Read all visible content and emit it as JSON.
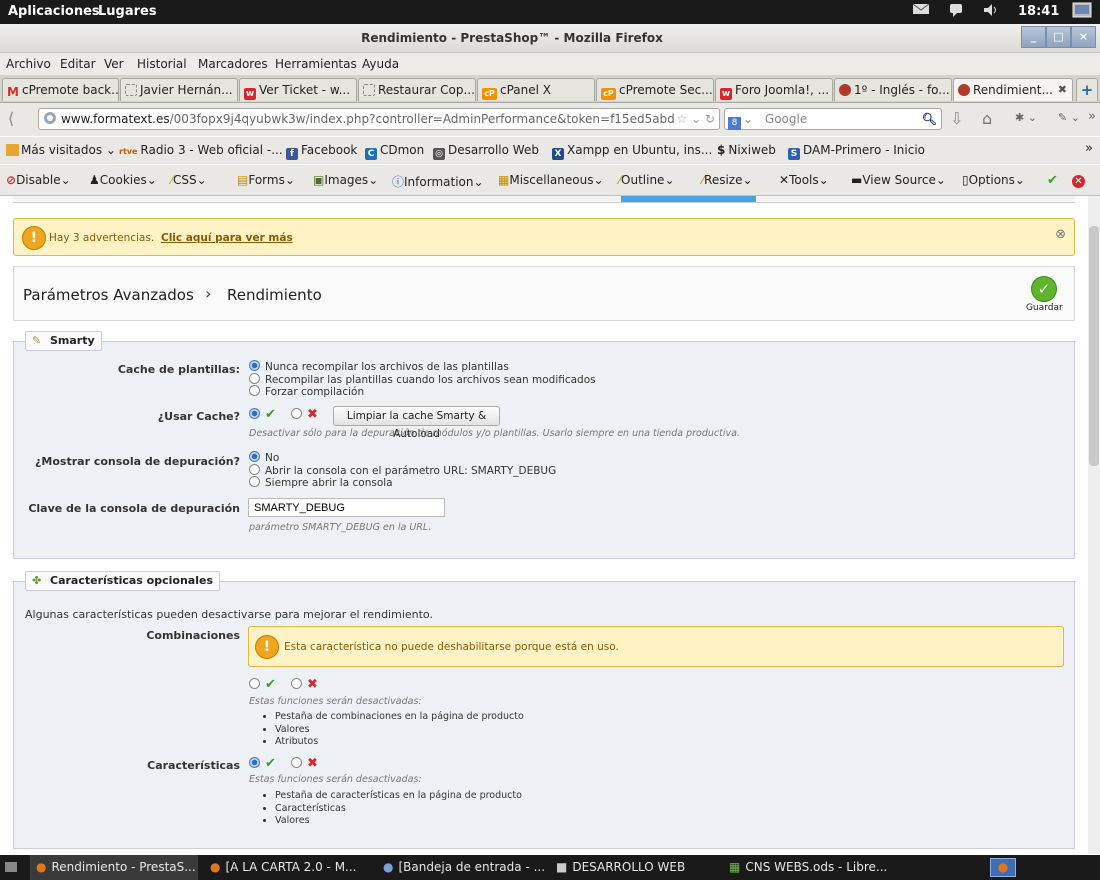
{
  "gnome_panel": {
    "apps_menu": "Aplicaciones",
    "places_menu": "Lugares",
    "clock": "18:41"
  },
  "window": {
    "title": "Rendimiento - PrestaShop™ - Mozilla Firefox",
    "minimize": "_",
    "maximize": "□",
    "close": "×"
  },
  "menubar": [
    "Archivo",
    "Editar",
    "Ver",
    "Historial",
    "Marcadores",
    "Herramientas",
    "Ayuda"
  ],
  "tabs": [
    {
      "label": "cPremote back...",
      "favicon": "gmail-icon",
      "favicon_color": "#d93025",
      "favicon_char": "M"
    },
    {
      "label": "Javier Hernán...",
      "favicon": "blank-page-icon",
      "favicon_color": "#ffffff",
      "favicon_char": ""
    },
    {
      "label": "Ver Ticket - w...",
      "favicon": "w-icon",
      "favicon_color": "#d8262a",
      "favicon_char": "w"
    },
    {
      "label": "Restaurar Cop...",
      "favicon": "blank-page-icon",
      "favicon_color": "#ffffff",
      "favicon_char": ""
    },
    {
      "label": "cPanel X",
      "favicon": "cpanel-icon",
      "favicon_color": "#f39200",
      "favicon_char": "cP"
    },
    {
      "label": "cPremote Sec...",
      "favicon": "cpanel-icon",
      "favicon_color": "#f39200",
      "favicon_char": "cP"
    },
    {
      "label": "Foro Joomla!, ...",
      "favicon": "w-icon",
      "favicon_color": "#d8262a",
      "favicon_char": "w"
    },
    {
      "label": "1º - Inglés - fo...",
      "favicon": "prestashop-icon",
      "favicon_color": "#b33a2a",
      "favicon_char": ""
    },
    {
      "label": "Rendimient...",
      "favicon": "prestashop-icon",
      "favicon_color": "#b33a2a",
      "favicon_char": ""
    }
  ],
  "tab_close": "✖",
  "new_tab": "+",
  "navbar": {
    "url_domain": "www.formatext.es",
    "url_rest": "/003fopx9j4qyubwk3w/index.php?controller=AdminPerformance&token=f15ed5abdcd",
    "search_placeholder": "Google"
  },
  "bookmarks": [
    "Más visitados",
    "Radio 3 - Web oficial -...",
    "Facebook",
    "CDmon",
    "Desarrollo Web",
    "Xampp en Ubuntu, ins...",
    "Nixiweb",
    "DAM-Primero - Inicio"
  ],
  "bookmark_icons": {
    "rtve": "rtve",
    "cdmon": "C",
    "xampp": "X",
    "nixiweb": "$",
    "dam": "S"
  },
  "devbar": [
    "Disable",
    "Cookies",
    "CSS",
    "Forms",
    "Images",
    "Information",
    "Miscellaneous",
    "Outline",
    "Resize",
    "Tools",
    "View Source",
    "Options"
  ],
  "warning_bar": {
    "text": "Hay 3 advertencias.",
    "link": "Clic aquí para ver más",
    "close": "⊗"
  },
  "breadcrumb": {
    "parent": "Parámetros Avanzados",
    "separator": "›",
    "current": "Rendimiento",
    "save_label": "Guardar"
  },
  "smarty": {
    "legend": "Smarty",
    "cache_label": "Cache de plantillas:",
    "cache_options": [
      "Nunca recompilar los archivos de las plantillas",
      "Recompilar las plantillas cuando los archivos sean modificados",
      "Forzar compilación"
    ],
    "cache_selected": 0,
    "use_cache_label": "¿Usar Cache?",
    "use_cache_yes": true,
    "clear_cache_button": "Limpiar la cache Smarty & Autoload",
    "use_cache_help": "Desactivar sólo para la depuración de módulos y/o plantillas. Usarlo siempre en una tienda productiva.",
    "debug_label": "¿Mostrar consola de depuración?",
    "debug_options": [
      "No",
      "Abrir la consola con el parámetro URL: SMARTY_DEBUG",
      "Siempre abrir la consola"
    ],
    "debug_selected": 0,
    "debug_key_label": "Clave de la consola de depuración",
    "debug_key_value": "SMARTY_DEBUG",
    "debug_key_help": "parámetro SMARTY_DEBUG en la URL."
  },
  "optional": {
    "legend": "Características opcionales",
    "intro": "Algunas características pueden desactivarse para mejorar el rendimiento.",
    "combinations_label": "Combinaciones",
    "combinations_warning": "Esta característica no puede deshabilitarse porque está en uso.",
    "combinations_enabled": null,
    "disabled_help": "Estas funciones serán desactivadas:",
    "combinations_list": [
      "Pestaña de combinaciones en la página de producto",
      "Valores",
      "Atributos"
    ],
    "features_label": "Características",
    "features_enabled": true,
    "features_list": [
      "Pestaña de características en la página de producto",
      "Características",
      "Valores"
    ]
  },
  "taskbar": [
    {
      "label": "Rendimiento - PrestaS...",
      "icon": "firefox-icon"
    },
    {
      "label": "[A LA CARTA 2.0 - M...",
      "icon": "firefox-icon"
    },
    {
      "label": "[Bandeja de entrada - ...",
      "icon": "thunderbird-icon"
    },
    {
      "label": "DESARROLLO WEB",
      "icon": "folder-icon"
    },
    {
      "label": "CNS WEBS.ods - Libre...",
      "icon": "spreadsheet-icon"
    }
  ]
}
